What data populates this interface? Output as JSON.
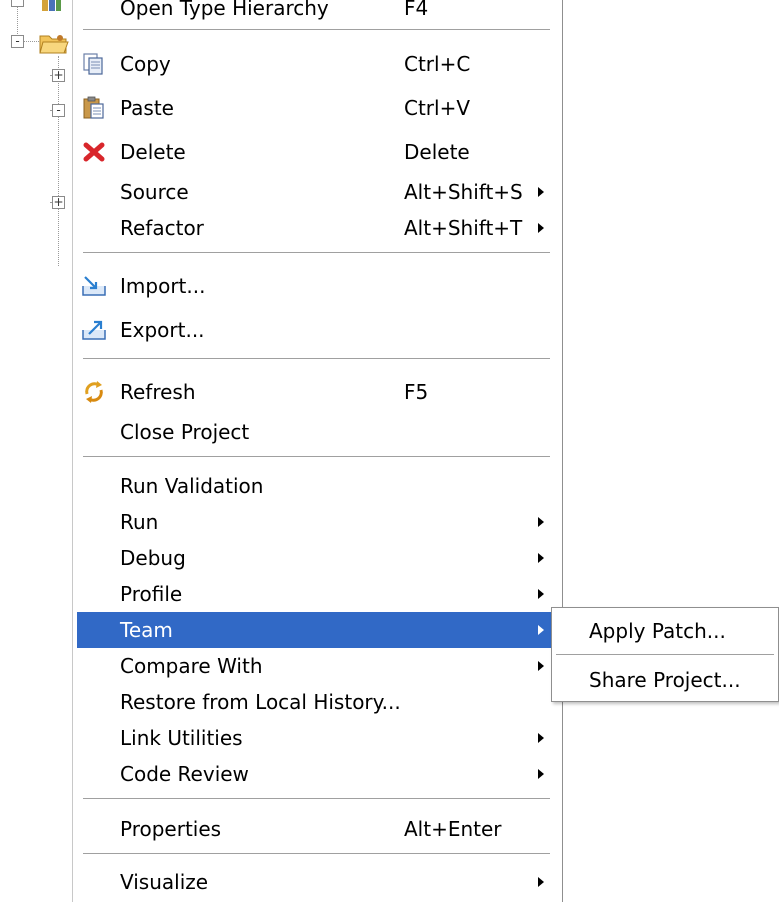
{
  "menu": {
    "items": [
      {
        "label": "Open Type Hierarchy",
        "shortcut": "F4",
        "icon": "type-hierarchy-icon"
      },
      {
        "label": "Copy",
        "shortcut": "Ctrl+C",
        "icon": "copy-icon"
      },
      {
        "label": "Paste",
        "shortcut": "Ctrl+V",
        "icon": "paste-icon"
      },
      {
        "label": "Delete",
        "shortcut": "Delete",
        "icon": "delete-icon"
      },
      {
        "label": "Source",
        "shortcut": "Alt+Shift+S"
      },
      {
        "label": "Refactor",
        "shortcut": "Alt+Shift+T"
      },
      {
        "label": "Import...",
        "icon": "import-icon"
      },
      {
        "label": "Export...",
        "icon": "export-icon"
      },
      {
        "label": "Refresh",
        "shortcut": "F5",
        "icon": "refresh-icon"
      },
      {
        "label": "Close Project"
      },
      {
        "label": "Run Validation"
      },
      {
        "label": "Run"
      },
      {
        "label": "Debug"
      },
      {
        "label": "Profile"
      },
      {
        "label": "Team",
        "selected": true
      },
      {
        "label": "Compare With"
      },
      {
        "label": "Restore from Local History..."
      },
      {
        "label": "Link Utilities"
      },
      {
        "label": "Code Review"
      },
      {
        "label": "Properties",
        "shortcut": "Alt+Enter"
      },
      {
        "label": "Visualize"
      }
    ]
  },
  "submenu": {
    "items": [
      {
        "label": "Apply Patch..."
      },
      {
        "label": "Share Project..."
      }
    ]
  },
  "colors": {
    "selection": "#3169c6",
    "selection_text": "#ffffff",
    "delete_icon": "#d8262b"
  },
  "tree": {
    "expanders": [
      "-",
      "+",
      "-",
      "+"
    ]
  }
}
